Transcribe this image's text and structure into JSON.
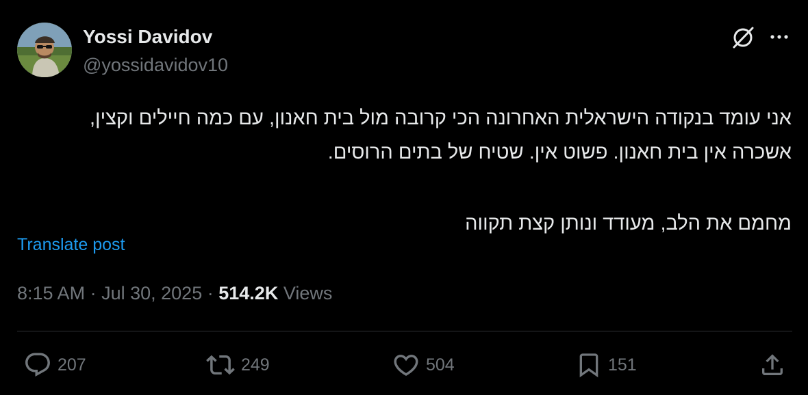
{
  "author": {
    "name": "Yossi Davidov",
    "handle": "@yossidavidov10"
  },
  "post": {
    "lines": [
      "אני עומד בנקודה הישראלית האחרונה הכי קרובה מול בית חאנון, עם כמה חיילים וקצין,",
      "אשכרה אין בית חאנון. פשוט אין. שטיח של בתים הרוסים.",
      "מחמם את הלב, מעודד ונותן קצת תקווה"
    ],
    "translate_label": "Translate post"
  },
  "meta": {
    "time": "8:15 AM",
    "separator": "·",
    "date": "Jul 30, 2025",
    "views_count": "514.2K",
    "views_label": "Views"
  },
  "actions": {
    "replies": "207",
    "reposts": "249",
    "likes": "504",
    "bookmarks": "151"
  },
  "icons": {
    "top_right": [
      "grok-icon",
      "more-icon"
    ],
    "actions": [
      "reply-icon",
      "repost-icon",
      "like-icon",
      "bookmark-icon",
      "share-icon"
    ]
  },
  "colors": {
    "background": "#000000",
    "text": "#e7e9ea",
    "secondary": "#71767b",
    "link": "#1d9bf0",
    "divider": "#2f3336"
  }
}
